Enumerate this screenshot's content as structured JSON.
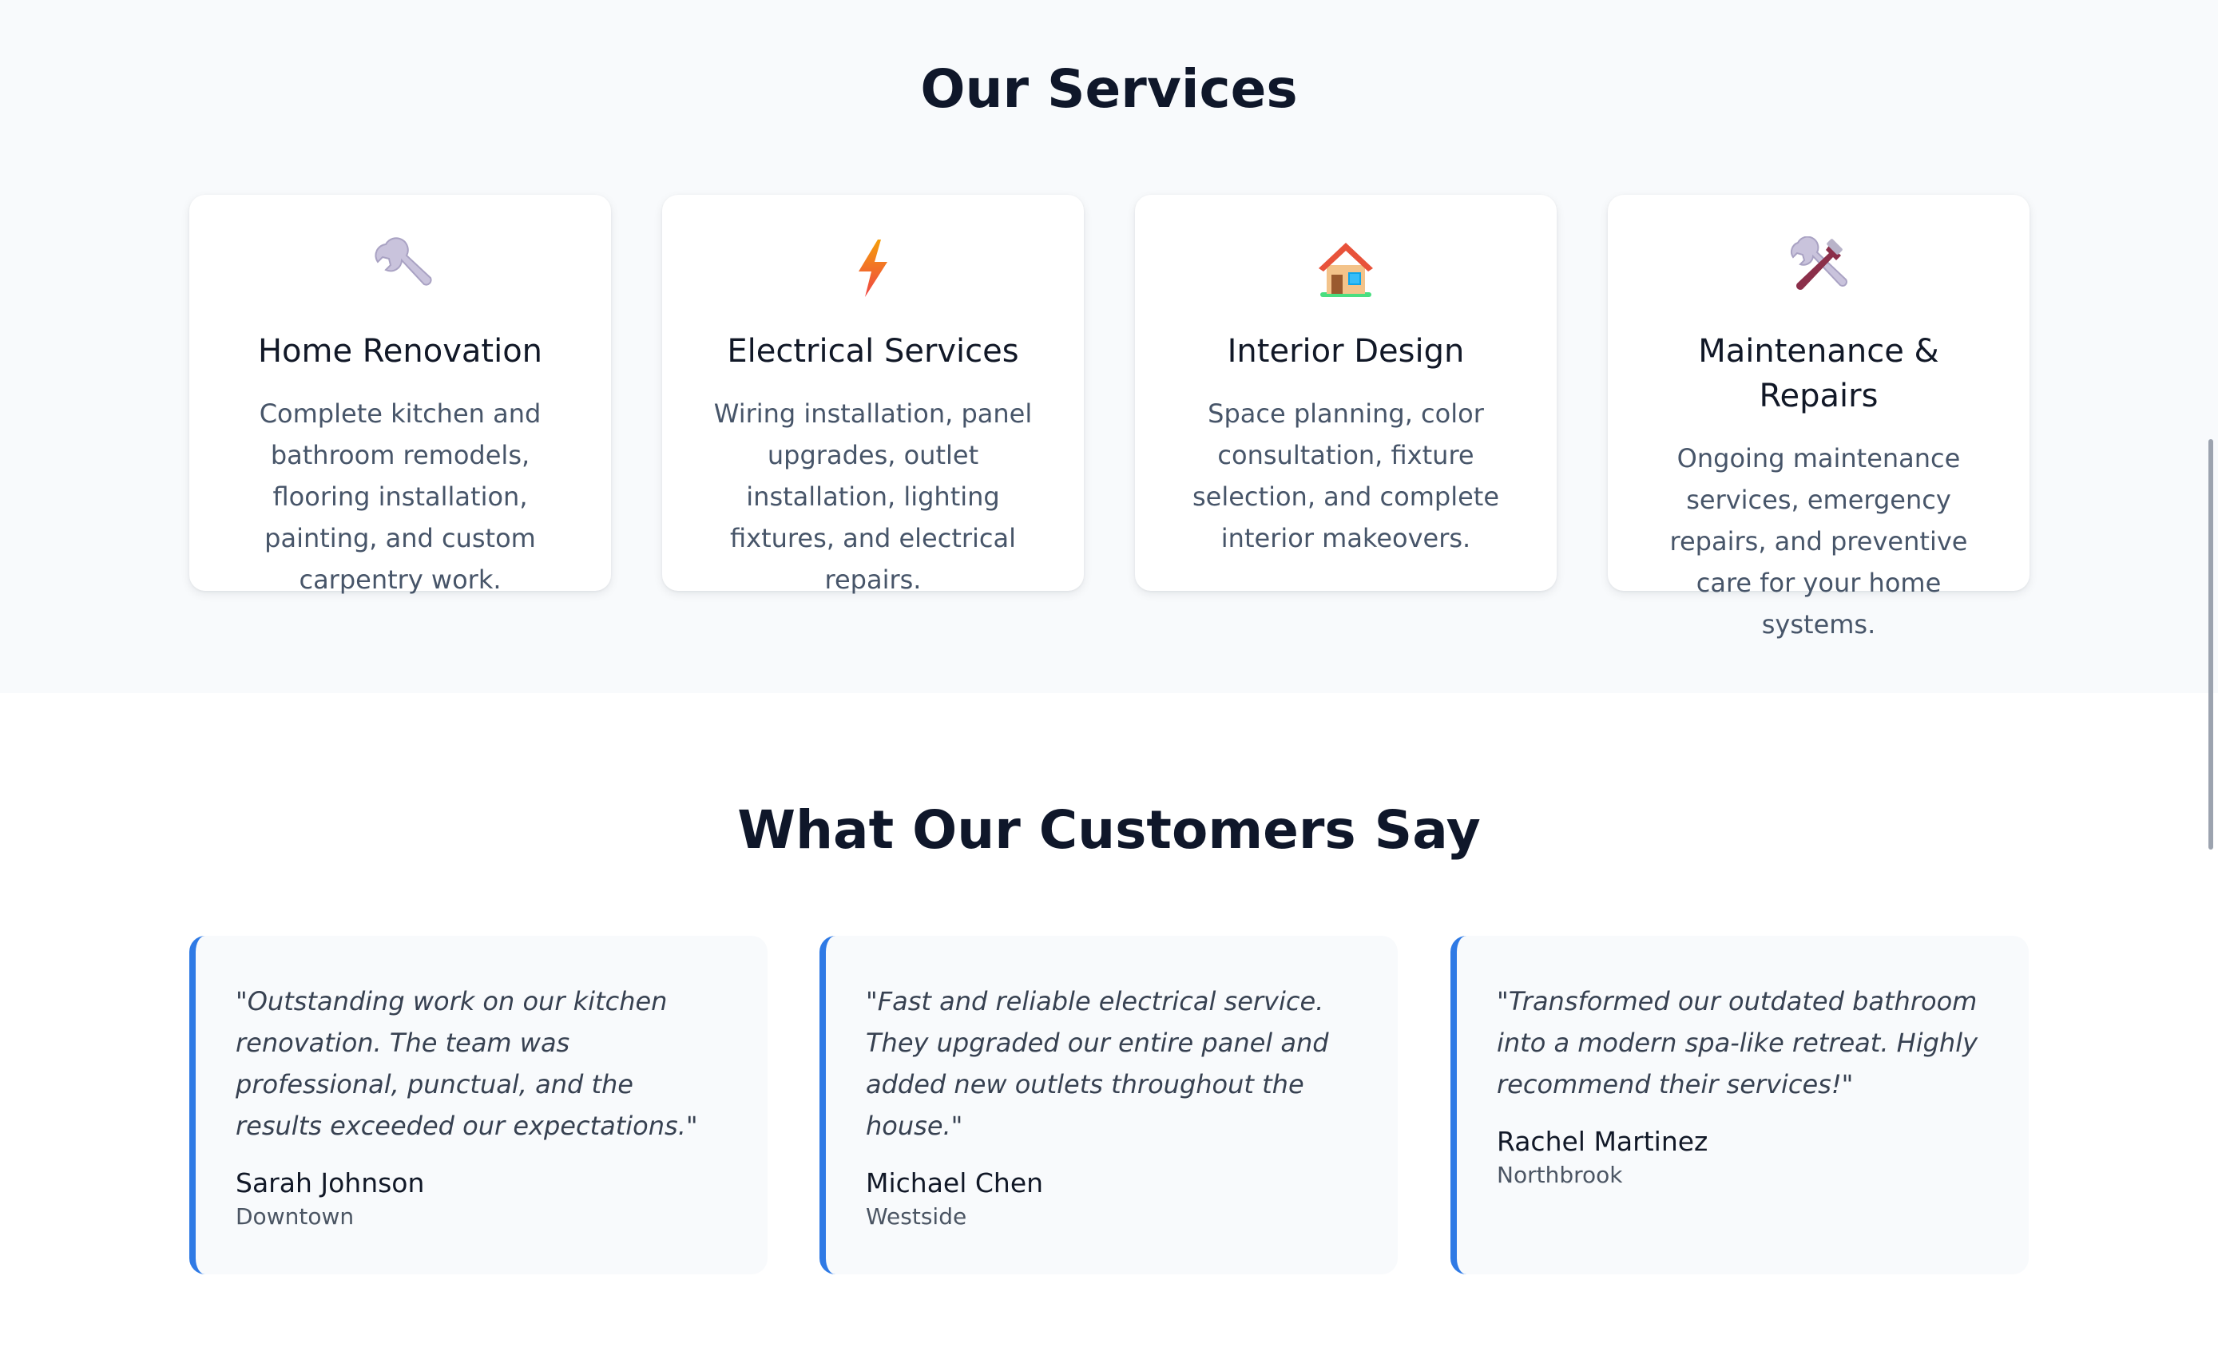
{
  "services": {
    "title": "Our Services",
    "cards": [
      {
        "icon": "wrench-icon",
        "title": "Home Renovation",
        "description": "Complete kitchen and bathroom remodels, flooring installation, painting, and custom carpentry work."
      },
      {
        "icon": "lightning-icon",
        "title": "Electrical Services",
        "description": "Wiring installation, panel upgrades, outlet installation, lighting fixtures, and electrical repairs."
      },
      {
        "icon": "house-icon",
        "title": "Interior Design",
        "description": "Space planning, color consultation, fixture selection, and complete interior makeovers."
      },
      {
        "icon": "hammer-wrench-icon",
        "title": "Maintenance & Repairs",
        "description": "Ongoing maintenance services, emergency repairs, and preventive care for your home systems."
      }
    ]
  },
  "testimonials": {
    "title": "What Our Customers Say",
    "items": [
      {
        "quote": "\"Outstanding work on our kitchen renovation. The team was professional, punctual, and the results exceeded our expectations.\"",
        "name": "Sarah Johnson",
        "location": "Downtown"
      },
      {
        "quote": "\"Fast and reliable electrical service. They upgraded our entire panel and added new outlets throughout the house.\"",
        "name": "Michael Chen",
        "location": "Westside"
      },
      {
        "quote": "\"Transformed our outdated bathroom into a modern spa-like retreat. Highly recommend their services!\"",
        "name": "Rachel Martinez",
        "location": "Northbrook"
      }
    ]
  },
  "colors": {
    "accent": "#2f7ae5",
    "section_bg": "#f8fafc",
    "heading": "#0f172a",
    "body_text": "#475569"
  }
}
